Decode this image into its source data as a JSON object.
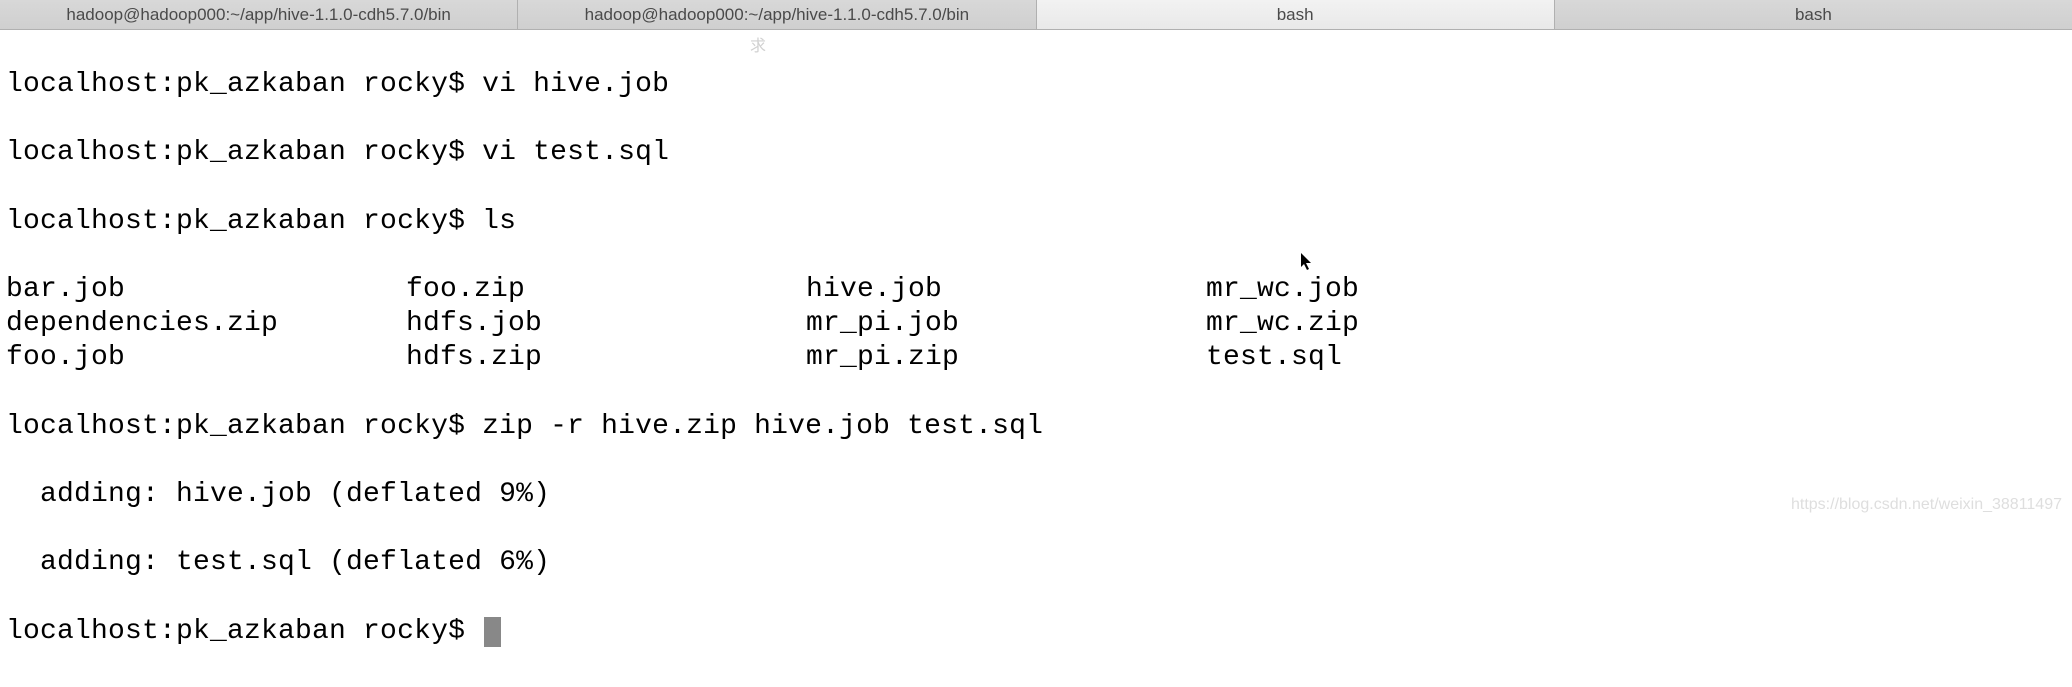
{
  "tabs": [
    {
      "label": "hadoop@hadoop000:~/app/hive-1.1.0-cdh5.7.0/bin",
      "active": false
    },
    {
      "label": "hadoop@hadoop000:~/app/hive-1.1.0-cdh5.7.0/bin",
      "active": false
    },
    {
      "label": "bash",
      "active": true
    },
    {
      "label": "bash",
      "active": false
    }
  ],
  "prompt": "localhost:pk_azkaban rocky$ ",
  "lines": {
    "l1_cmd": "vi hive.job",
    "l2_cmd": "vi test.sql",
    "l3_cmd": "ls",
    "l_zip_cmd": "zip -r hive.zip hive.job test.sql",
    "l_add1": "  adding: hive.job (deflated 9%)",
    "l_add2": "  adding: test.sql (deflated 6%)"
  },
  "ls": {
    "row1": [
      "bar.job",
      "foo.zip",
      "hive.job",
      "mr_wc.job"
    ],
    "row2": [
      "dependencies.zip",
      "hdfs.job",
      "mr_pi.job",
      "mr_wc.zip"
    ],
    "row3": [
      "foo.job",
      "hdfs.zip",
      "mr_pi.zip",
      "test.sql"
    ]
  },
  "watermark_cn": "求",
  "watermark_url": "https://blog.csdn.net/weixin_38811497"
}
